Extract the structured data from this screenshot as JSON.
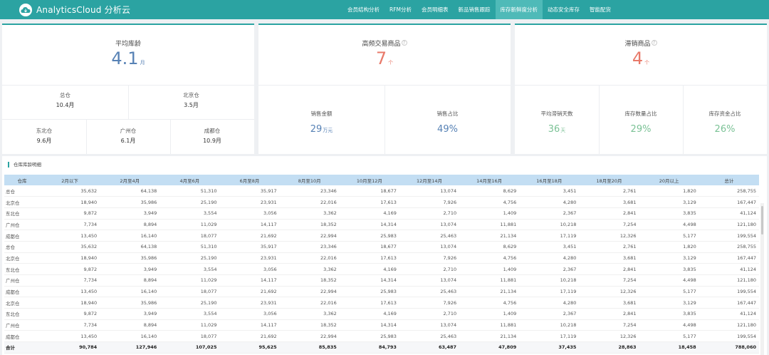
{
  "brand": {
    "name": "AnalyticsCloud 分析云"
  },
  "nav": [
    "会员结构分析",
    "RFM分析",
    "会员明细表",
    "新品销售跟踪",
    "库存新鲜度分析",
    "动态安全库存",
    "智能配货"
  ],
  "nav_active_index": 4,
  "card_avg_age": {
    "title": "平均库龄",
    "value": "4.1",
    "unit": "月",
    "cells": [
      {
        "label": "总仓",
        "value": "10.4月"
      },
      {
        "label": "北京仓",
        "value": "3.5月"
      },
      {
        "label": "东北仓",
        "value": "9.6月"
      },
      {
        "label": "广州仓",
        "value": "6.1月"
      },
      {
        "label": "成都仓",
        "value": "10.9月"
      }
    ]
  },
  "card_hot": {
    "title": "高频交易商品",
    "value": "7",
    "unit": "个",
    "metrics": [
      {
        "label": "销售金额",
        "value": "29",
        "unit": "万元"
      },
      {
        "label": "销售占比",
        "value": "49%",
        "unit": ""
      }
    ]
  },
  "card_slow": {
    "title": "滞销商品",
    "value": "4",
    "unit": "个",
    "metrics": [
      {
        "label": "平均滞销天数",
        "value": "36",
        "unit": "天"
      },
      {
        "label": "库存数量占比",
        "value": "29%",
        "unit": ""
      },
      {
        "label": "库存资金占比",
        "value": "26%",
        "unit": ""
      }
    ]
  },
  "colors": {
    "brand": "#2ba3a2",
    "blue": "#5782b5",
    "red": "#e87a6a",
    "green": "#7bc296",
    "header": "#c3def3"
  },
  "table": {
    "title": "仓库库龄明细",
    "headers": [
      "仓库",
      "2月以下",
      "2月至4月",
      "4月至6月",
      "6月至8月",
      "8月至10月",
      "10月至12月",
      "12月至14月",
      "14月至16月",
      "16月至18月",
      "18月至20月",
      "20月以上",
      "总计"
    ],
    "rows": [
      [
        "总仓",
        "35,632",
        "64,138",
        "51,310",
        "35,917",
        "23,346",
        "18,677",
        "13,074",
        "8,629",
        "3,451",
        "2,761",
        "1,820",
        "258,755"
      ],
      [
        "北京仓",
        "18,940",
        "35,986",
        "25,190",
        "23,931",
        "22,016",
        "17,613",
        "7,926",
        "4,756",
        "4,280",
        "3,681",
        "3,129",
        "167,447"
      ],
      [
        "东北仓",
        "9,872",
        "3,949",
        "3,554",
        "3,056",
        "3,362",
        "4,169",
        "2,710",
        "1,409",
        "2,367",
        "2,841",
        "3,835",
        "41,124"
      ],
      [
        "广州仓",
        "7,734",
        "8,894",
        "11,029",
        "14,117",
        "18,352",
        "14,314",
        "13,074",
        "11,881",
        "10,218",
        "7,254",
        "4,498",
        "121,180"
      ],
      [
        "成都仓",
        "13,450",
        "16,140",
        "18,077",
        "21,692",
        "22,994",
        "25,983",
        "25,463",
        "21,134",
        "17,119",
        "12,326",
        "5,177",
        "199,554"
      ],
      [
        "总仓",
        "35,632",
        "64,138",
        "51,310",
        "35,917",
        "23,346",
        "18,677",
        "13,074",
        "8,629",
        "3,451",
        "2,761",
        "1,820",
        "258,755"
      ],
      [
        "北京仓",
        "18,940",
        "35,986",
        "25,190",
        "23,931",
        "22,016",
        "17,613",
        "7,926",
        "4,756",
        "4,280",
        "3,681",
        "3,129",
        "167,447"
      ],
      [
        "东北仓",
        "9,872",
        "3,949",
        "3,554",
        "3,056",
        "3,362",
        "4,169",
        "2,710",
        "1,409",
        "2,367",
        "2,841",
        "3,835",
        "41,124"
      ],
      [
        "广州仓",
        "7,734",
        "8,894",
        "11,029",
        "14,117",
        "18,352",
        "14,314",
        "13,074",
        "11,881",
        "10,218",
        "7,254",
        "4,498",
        "121,180"
      ],
      [
        "成都仓",
        "13,450",
        "16,140",
        "18,077",
        "21,692",
        "22,994",
        "25,983",
        "25,463",
        "21,134",
        "17,119",
        "12,326",
        "5,177",
        "199,554"
      ],
      [
        "北京仓",
        "18,940",
        "35,986",
        "25,190",
        "23,931",
        "22,016",
        "17,613",
        "7,926",
        "4,756",
        "4,280",
        "3,681",
        "3,129",
        "167,447"
      ],
      [
        "东北仓",
        "9,872",
        "3,949",
        "3,554",
        "3,056",
        "3,362",
        "4,169",
        "2,710",
        "1,409",
        "2,367",
        "2,841",
        "3,835",
        "41,124"
      ],
      [
        "广州仓",
        "7,734",
        "8,894",
        "11,029",
        "14,117",
        "18,352",
        "14,314",
        "13,074",
        "11,881",
        "10,218",
        "7,254",
        "4,498",
        "121,180"
      ],
      [
        "成都仓",
        "13,450",
        "16,140",
        "18,077",
        "21,692",
        "22,994",
        "25,983",
        "25,463",
        "21,134",
        "17,119",
        "12,326",
        "5,177",
        "199,554"
      ]
    ],
    "total": [
      "合计",
      "90,784",
      "127,946",
      "107,025",
      "95,625",
      "85,835",
      "84,793",
      "63,487",
      "47,809",
      "37,435",
      "28,863",
      "18,458",
      "788,060"
    ]
  }
}
